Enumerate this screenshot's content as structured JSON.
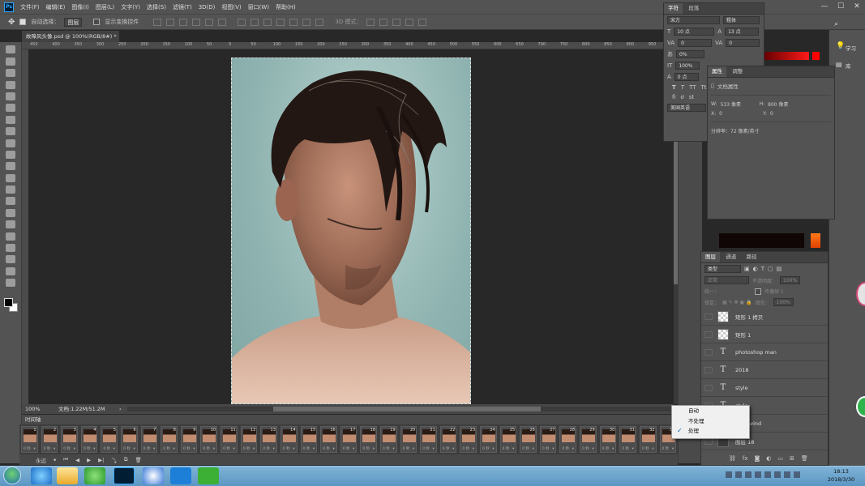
{
  "menubar": {
    "items": [
      "文件(F)",
      "编辑(E)",
      "图像(I)",
      "图层(L)",
      "文字(Y)",
      "选择(S)",
      "滤镜(T)",
      "3D(D)",
      "视图(V)",
      "窗口(W)",
      "帮助(H)"
    ],
    "window_buttons": [
      "—",
      "☐",
      "✕"
    ]
  },
  "options": {
    "auto_select_label": "自动选择：",
    "auto_select_value": "图层",
    "show_transform_label": "显示变换控件",
    "mode_3d_label": "3D 模式："
  },
  "document": {
    "tab_title": "故障风头像.psd @ 100%(RGB/8#) *",
    "zoom": "100%",
    "doc_info": "文档:1.22M/51.2M",
    "ruler_ticks": [
      "450",
      "400",
      "350",
      "300",
      "250",
      "200",
      "150",
      "100",
      "50",
      "0",
      "50",
      "100",
      "150",
      "200",
      "250",
      "300",
      "350",
      "400",
      "450",
      "500",
      "550",
      "600",
      "650",
      "700",
      "750",
      "800",
      "850",
      "900",
      "950"
    ]
  },
  "timeline": {
    "title": "时间轴",
    "frame_duration": "0 秒",
    "frame_numbers": [
      "1",
      "2",
      "3",
      "4",
      "5",
      "6",
      "7",
      "8",
      "9",
      "10",
      "11",
      "12",
      "13",
      "14",
      "15",
      "16",
      "17",
      "18",
      "19",
      "20",
      "21",
      "22",
      "23",
      "24",
      "25",
      "26",
      "27",
      "28",
      "29",
      "30",
      "31",
      "32",
      "33"
    ],
    "loop_label": "永远"
  },
  "character_panel": {
    "tabs": [
      "字符",
      "段落"
    ],
    "font_family": "宋方",
    "font_style": "粗体",
    "font_size": "10 点",
    "leading": "13 点",
    "kerning": "0",
    "tracking": "0",
    "scale_pct": "0%",
    "vertical_scale": "100%",
    "baseline": "0 点",
    "language": "美国英语"
  },
  "properties_panel": {
    "tabs": [
      "属性",
      "调整"
    ],
    "title": "文档属性",
    "w_label": "W:",
    "w_value": "533 像素",
    "h_label": "H:",
    "h_value": "800 像素",
    "x_label": "X:",
    "x_value": "0",
    "y_label": "Y:",
    "y_value": "0",
    "resolution": "分辨率：72 像素/英寸"
  },
  "layers_panel": {
    "tabs": [
      "图层",
      "通道",
      "路径"
    ],
    "kind_filter": "类型",
    "blend_mode": "正常",
    "opacity_label": "不透明度：",
    "opacity_value": "100%",
    "lock_label": "锁定：",
    "fill_label": "填充：",
    "fill_value": "100%",
    "unify_label": "统一：",
    "propagate_label": "传播帧 1",
    "layers": [
      {
        "name": "矩形 1 拷贝",
        "type": "shape"
      },
      {
        "name": "矩形 1",
        "type": "shape"
      },
      {
        "name": "photoshop man",
        "type": "text"
      },
      {
        "name": "2018",
        "type": "text"
      },
      {
        "name": "style",
        "type": "text"
      },
      {
        "name": "style",
        "type": "text"
      },
      {
        "name": "fault wind",
        "type": "text"
      },
      {
        "name": "图层 18",
        "type": "pixel"
      }
    ]
  },
  "context_menu": {
    "items": [
      {
        "label": "自动",
        "checked": false
      },
      {
        "label": "不处理",
        "checked": false
      },
      {
        "label": "处理",
        "checked": true
      }
    ]
  },
  "right_dock": {
    "learn_label": "学习",
    "library_label": "库"
  },
  "taskbar": {
    "time": "18:13",
    "date": "2018/3/30"
  },
  "colors": {
    "ui_dark": "#535353",
    "canvas_bg": "#282828",
    "accent_red": "#ff0000",
    "accent_orange": "#ff7a1a",
    "ps_blue": "#31a8ff"
  }
}
